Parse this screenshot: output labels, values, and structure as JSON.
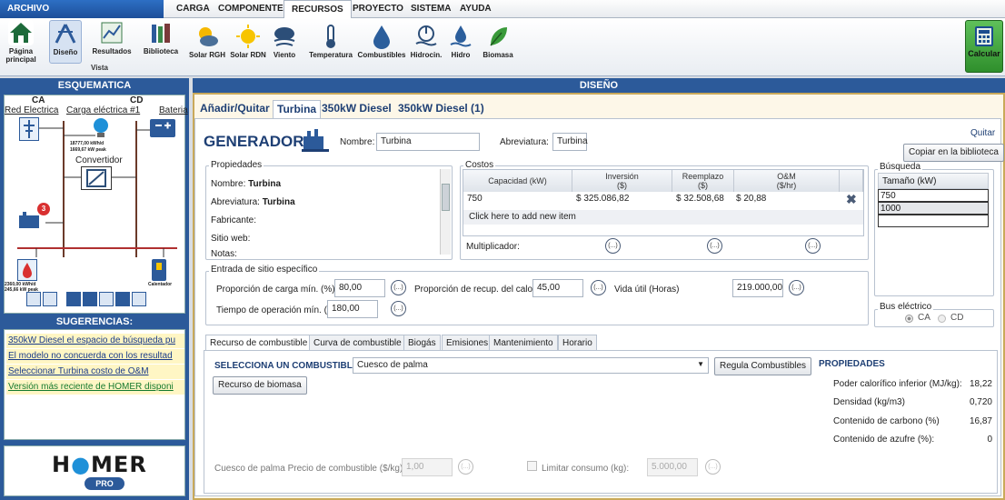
{
  "menu": {
    "archivo": "ARCHIVO",
    "items": [
      "CARGA",
      "COMPONENTES",
      "RECURSOS",
      "PROYECTO",
      "SISTEMA",
      "AYUDA"
    ]
  },
  "ribbon": {
    "home": "Página principal",
    "design": "Diseño",
    "results": "Resultados",
    "library": "Biblioteca",
    "view_label": "Vista",
    "resources": [
      "Solar RGH",
      "Solar RDN",
      "Viento",
      "Temperatura",
      "Combustibles",
      "Hidrocin.",
      "Hidro",
      "Biomasa"
    ],
    "calculate": "Calcular"
  },
  "schematic": {
    "header": "ESQUEMATICA",
    "ca": "CA",
    "cd": "CD",
    "red_electrica": "Red Electrica",
    "carga": "Carga eléctrica #1",
    "bateria": "Bateria",
    "load1_kwh": "18777,00 kWh/d",
    "load1_peak": "1669,67 kW peak",
    "convertidor": "Convertidor",
    "gen_badge": "3",
    "load2_kwh": "2360,00 kWh/d",
    "load2_peak": "245,66 kW peak",
    "calentador": "Calentador"
  },
  "suggestions": {
    "header": "SUGERENCIAS:",
    "items": [
      "350kW Diesel el espacio de búsqueda pu",
      "El modelo no concuerda con los resultad",
      "Seleccionar Turbina costo de O&M",
      "Versión más reciente de HOMER disponi"
    ]
  },
  "logo": {
    "text1": "H",
    "text2": "MER",
    "pro": "PRO"
  },
  "design": {
    "header": "DISEÑO",
    "tabs": [
      "Añadir/Quitar",
      "Turbina",
      "350kW Diesel",
      "350kW Diesel (1)"
    ],
    "generator_title": "GENERADOR",
    "name_label": "Nombre:",
    "name_value": "Turbina",
    "abbr_label": "Abreviatura:",
    "abbr_value": "Turbina",
    "remove": "Quitar",
    "copy_library": "Copiar en la biblioteca",
    "properties": {
      "title": "Propiedades",
      "rows": [
        {
          "label": "Nombre:",
          "value": "Turbina"
        },
        {
          "label": "Abreviatura:",
          "value": "Turbina"
        },
        {
          "label": "Fabricante:",
          "value": ""
        },
        {
          "label": "Sitio web:",
          "value": ""
        },
        {
          "label": "Notas:",
          "value": ""
        }
      ]
    },
    "costs": {
      "title": "Costos",
      "headers": [
        "Capacidad (kW)",
        "Inversión\n($)",
        "Reemplazo\n($)",
        "O&M\n($/hr)"
      ],
      "h_cap": "Capacidad (kW)",
      "h_inv1": "Inversión",
      "h_inv2": "($)",
      "h_rep1": "Reemplazo",
      "h_rep2": "($)",
      "h_om1": "O&M",
      "h_om2": "($/hr)",
      "row": {
        "cap": "750",
        "inv": "$ 325.086,82",
        "rep": "$ 32.508,68",
        "om": "$ 20,88"
      },
      "add_new": "Click here to add new item",
      "multiplier": "Multiplicador:"
    },
    "search": {
      "title": "Búsqueda",
      "header": "Tamaño (kW)",
      "rows": [
        "750",
        "1000"
      ]
    },
    "site": {
      "title": "Entrada de sitio específico",
      "min_load_label": "Proporción de carga mín. (%):",
      "min_load_value": "80,00",
      "heat_recovery_label": "Proporción de recup. del calo",
      "heat_recovery_value": "45,00",
      "lifetime_label": "Vida útil (Horas)",
      "lifetime_value": "219.000,00",
      "min_runtime_label": "Tiempo de operación mín. (m",
      "min_runtime_value": "180,00"
    },
    "bus": {
      "title": "Bus eléctrico",
      "ca": "CA",
      "cd": "CD",
      "selected": "CA"
    },
    "bottom_tabs": [
      "Recurso de combustible",
      "Curva de combustible",
      "Biogás",
      "Emisiones",
      "Mantenimiento",
      "Horario"
    ],
    "fuel": {
      "select_label": "SELECCIONA UN COMBUSTIBLE:",
      "selected": "Cuesco de palma",
      "regulate": "Regula Combustibles",
      "biomass_button": "Recurso de biomasa",
      "price_label": "Cuesco de palma Precio de combustible ($/kg):",
      "price_value": "1,00",
      "limit_label": "Limitar consumo (kg):",
      "limit_value": "5.000,00"
    },
    "fuel_props": {
      "title": "PROPIEDADES",
      "rows": [
        {
          "label": "Poder calorífico inferior (MJ/kg):",
          "value": "18,22"
        },
        {
          "label": "Densidad (kg/m3)",
          "value": "0,720"
        },
        {
          "label": "Contenido de carbono (%)",
          "value": "16,87"
        },
        {
          "label": "Contenido de azufre (%):",
          "value": "0"
        }
      ]
    }
  },
  "colors": {
    "brand_blue": "#2c5a9a",
    "title_blue": "#1e3f74",
    "panel_border": "#c9a95a",
    "calc_green": "#3fa03a"
  }
}
